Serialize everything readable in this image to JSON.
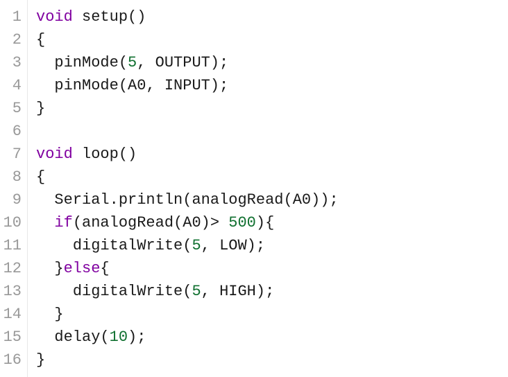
{
  "code": {
    "lines": [
      {
        "n": "1",
        "indent": 0,
        "tokens": [
          [
            "kw-type",
            "void"
          ],
          [
            "plain",
            " "
          ],
          [
            "fn",
            "setup"
          ],
          [
            "punct",
            "()"
          ]
        ]
      },
      {
        "n": "2",
        "indent": 0,
        "tokens": [
          [
            "punct",
            "{"
          ]
        ]
      },
      {
        "n": "3",
        "indent": 1,
        "tokens": [
          [
            "fn",
            "pinMode"
          ],
          [
            "punct",
            "("
          ],
          [
            "num",
            "5"
          ],
          [
            "punct",
            ", "
          ],
          [
            "plain",
            "OUTPUT"
          ],
          [
            "punct",
            ");"
          ]
        ]
      },
      {
        "n": "4",
        "indent": 1,
        "tokens": [
          [
            "fn",
            "pinMode"
          ],
          [
            "punct",
            "("
          ],
          [
            "plain",
            "A0"
          ],
          [
            "punct",
            ", "
          ],
          [
            "plain",
            "INPUT"
          ],
          [
            "punct",
            ");"
          ]
        ]
      },
      {
        "n": "5",
        "indent": 0,
        "tokens": [
          [
            "punct",
            "}"
          ]
        ]
      },
      {
        "n": "6",
        "indent": 0,
        "tokens": []
      },
      {
        "n": "7",
        "indent": 0,
        "tokens": [
          [
            "kw-type",
            "void"
          ],
          [
            "plain",
            " "
          ],
          [
            "fn",
            "loop"
          ],
          [
            "punct",
            "()"
          ]
        ]
      },
      {
        "n": "8",
        "indent": 0,
        "tokens": [
          [
            "punct",
            "{"
          ]
        ]
      },
      {
        "n": "9",
        "indent": 1,
        "tokens": [
          [
            "plain",
            "Serial"
          ],
          [
            "punct",
            "."
          ],
          [
            "fn",
            "println"
          ],
          [
            "punct",
            "("
          ],
          [
            "fn",
            "analogRead"
          ],
          [
            "punct",
            "("
          ],
          [
            "plain",
            "A0"
          ],
          [
            "punct",
            "));"
          ]
        ]
      },
      {
        "n": "10",
        "indent": 1,
        "tokens": [
          [
            "kw-ctrl",
            "if"
          ],
          [
            "punct",
            "("
          ],
          [
            "fn",
            "analogRead"
          ],
          [
            "punct",
            "("
          ],
          [
            "plain",
            "A0"
          ],
          [
            "punct",
            ")> "
          ],
          [
            "num",
            "500"
          ],
          [
            "punct",
            "){"
          ]
        ]
      },
      {
        "n": "11",
        "indent": 2,
        "tokens": [
          [
            "fn",
            "digitalWrite"
          ],
          [
            "punct",
            "("
          ],
          [
            "num",
            "5"
          ],
          [
            "punct",
            ", "
          ],
          [
            "plain",
            "LOW"
          ],
          [
            "punct",
            ");"
          ]
        ]
      },
      {
        "n": "12",
        "indent": 1,
        "tokens": [
          [
            "punct",
            "}"
          ],
          [
            "kw-ctrl",
            "else"
          ],
          [
            "punct",
            "{"
          ]
        ]
      },
      {
        "n": "13",
        "indent": 2,
        "tokens": [
          [
            "fn",
            "digitalWrite"
          ],
          [
            "punct",
            "("
          ],
          [
            "num",
            "5"
          ],
          [
            "punct",
            ", "
          ],
          [
            "plain",
            "HIGH"
          ],
          [
            "punct",
            ");"
          ]
        ]
      },
      {
        "n": "14",
        "indent": 1,
        "tokens": [
          [
            "punct",
            "}"
          ]
        ]
      },
      {
        "n": "15",
        "indent": 1,
        "tokens": [
          [
            "fn",
            "delay"
          ],
          [
            "punct",
            "("
          ],
          [
            "num",
            "10"
          ],
          [
            "punct",
            ");"
          ]
        ]
      },
      {
        "n": "16",
        "indent": 0,
        "tokens": [
          [
            "punct",
            "}"
          ]
        ]
      }
    ]
  }
}
